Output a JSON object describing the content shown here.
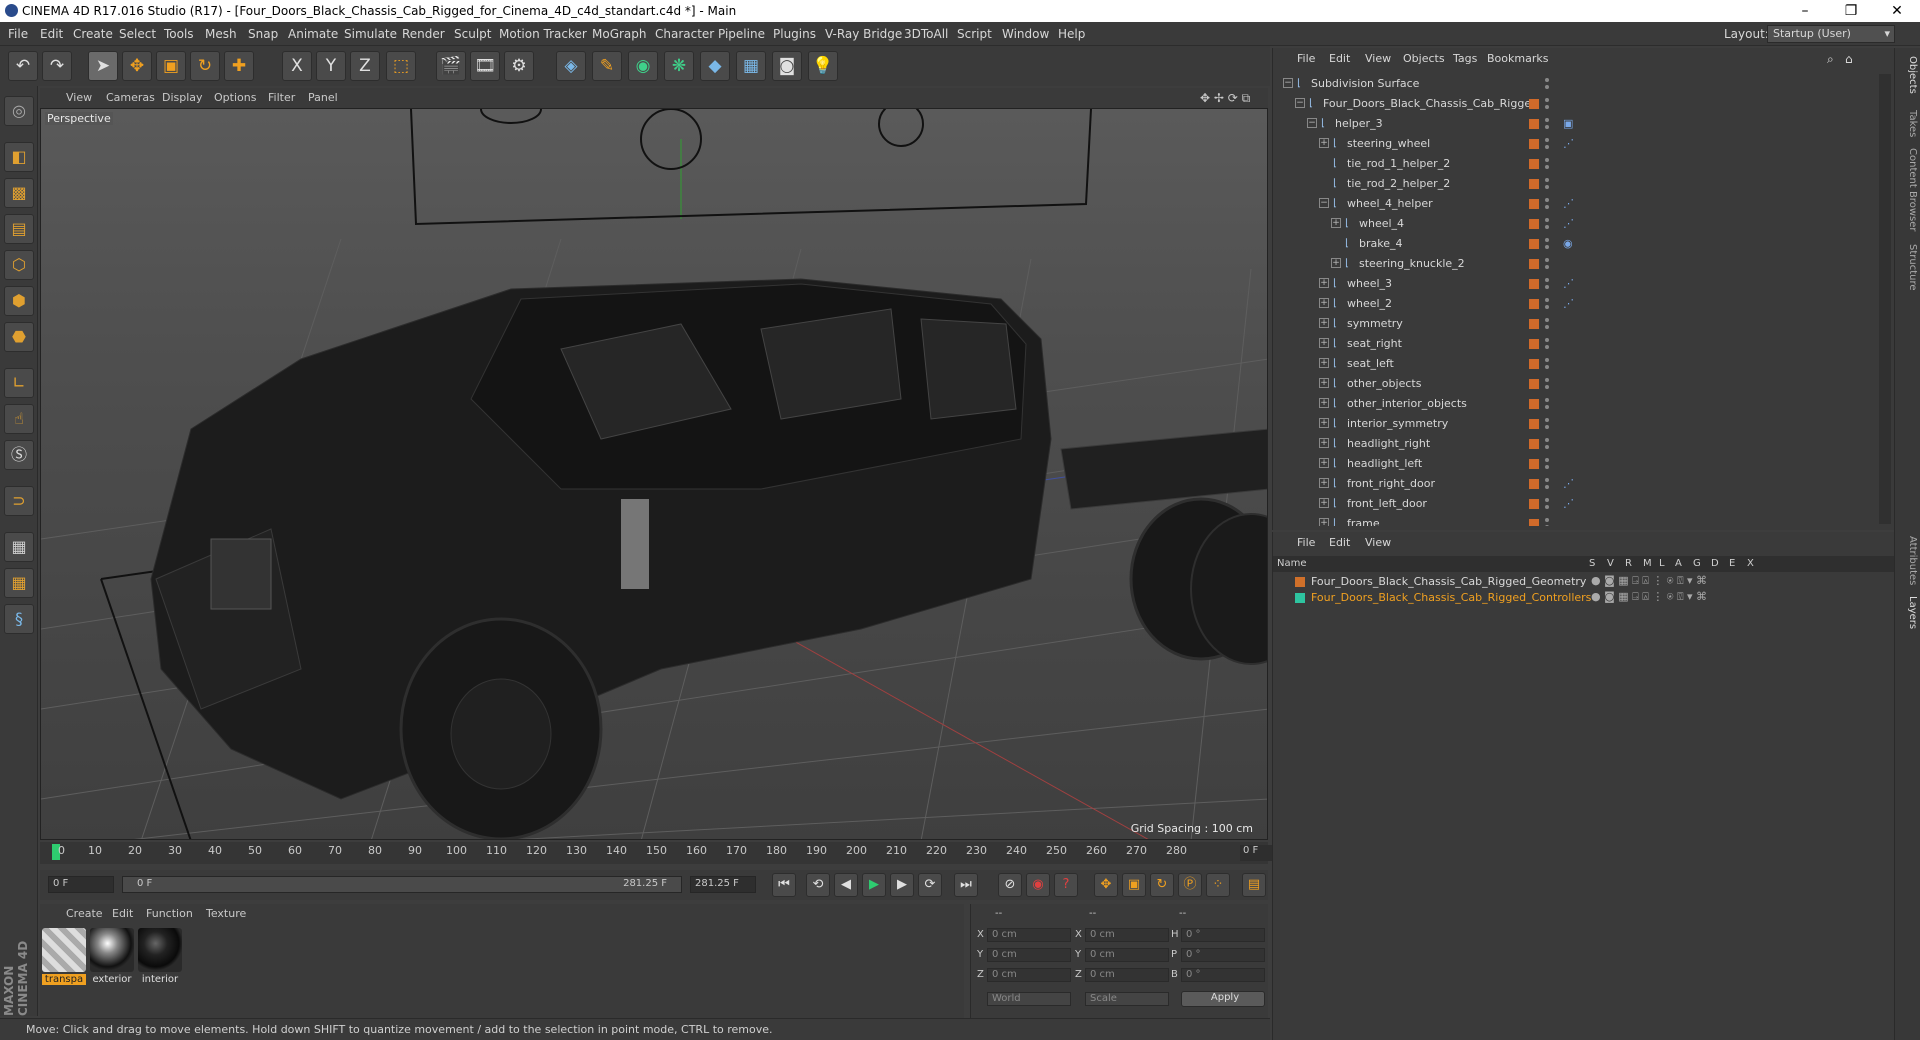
{
  "window": {
    "title": "CINEMA 4D R17.016 Studio (R17) - [Four_Doors_Black_Chassis_Cab_Rigged_for_Cinema_4D_c4d_standart.c4d *] - Main",
    "minimize": "–",
    "maximize": "❐",
    "close": "✕"
  },
  "menubar": {
    "items": [
      "File",
      "Edit",
      "Create",
      "Select",
      "Tools",
      "Mesh",
      "Snap",
      "Animate",
      "Simulate",
      "Render",
      "Sculpt",
      "Motion Tracker",
      "MoGraph",
      "Character",
      "Pipeline",
      "Plugins",
      "V-Ray Bridge",
      "3DToAll",
      "Script",
      "Window",
      "Help"
    ],
    "layout_label": "Layout:",
    "layout_value": "Startup (User)"
  },
  "toolbar": {
    "icons": [
      "undo-icon",
      "redo-icon",
      "select-cursor-icon",
      "move-icon",
      "scale-icon",
      "rotate-icon",
      "live-select-icon",
      "x-axis-icon",
      "y-axis-icon",
      "z-axis-icon",
      "coordinate-system-icon",
      "render-view-icon",
      "render-picture-viewer-icon",
      "edit-render-settings-icon",
      "cube-icon",
      "pen-icon",
      "subdivision-icon",
      "array-icon",
      "deformer-icon",
      "floor-icon",
      "camera-icon",
      "light-icon"
    ],
    "x_label": "X",
    "y_label": "Y",
    "z_label": "Z"
  },
  "lefttools": {
    "icons": [
      "make-editable-icon",
      "model-mode-icon",
      "texture-mode-icon",
      "workplane-icon",
      "points-mode-icon",
      "edges-mode-icon",
      "polygons-mode-icon",
      "axis-mode-icon",
      "tweak-icon",
      "solo-icon",
      "magnet-icon",
      "locked-workplane-icon",
      "snap-icon",
      "python-icon"
    ]
  },
  "viewport": {
    "menu": [
      "View",
      "Cameras",
      "Display",
      "Options",
      "Filter",
      "Panel"
    ],
    "label": "Perspective",
    "grid_spacing": "Grid Spacing : 100 cm"
  },
  "timeline": {
    "ticks": [
      "0",
      "10",
      "20",
      "30",
      "40",
      "50",
      "60",
      "70",
      "80",
      "90",
      "100",
      "110",
      "120",
      "130",
      "140",
      "150",
      "160",
      "170",
      "180",
      "190",
      "200",
      "210",
      "220",
      "230",
      "240",
      "250",
      "260",
      "270",
      "280"
    ],
    "current_frame": "0 F"
  },
  "transport": {
    "start": "0 F",
    "range_start": "0 F",
    "range_end": "281.25 F",
    "end": "281.25 F"
  },
  "materials": {
    "menu": [
      "Create",
      "Edit",
      "Function",
      "Texture"
    ],
    "items": [
      {
        "label": "transpa"
      },
      {
        "label": "exterior"
      },
      {
        "label": "interior"
      }
    ]
  },
  "coords": {
    "headers": [
      "--",
      "--",
      "--"
    ],
    "rows": [
      {
        "a": "X",
        "av": "0 cm",
        "b": "X",
        "bv": "0 cm",
        "c": "H",
        "cv": "0 °"
      },
      {
        "a": "Y",
        "av": "0 cm",
        "b": "Y",
        "bv": "0 cm",
        "c": "P",
        "cv": "0 °"
      },
      {
        "a": "Z",
        "av": "0 cm",
        "b": "Z",
        "bv": "0 cm",
        "c": "B",
        "cv": "0 °"
      }
    ],
    "world": "World",
    "scale": "Scale",
    "apply": "Apply"
  },
  "status": {
    "text": "Move: Click and drag to move elements. Hold down SHIFT to quantize movement / add to the selection in point mode, CTRL to remove.",
    "brand": "MAXON CINEMA 4D"
  },
  "objects": {
    "menu": [
      "File",
      "Edit",
      "View",
      "Objects",
      "Tags",
      "Bookmarks"
    ],
    "rows": [
      {
        "name": "Subdivision Surface",
        "depth": 0,
        "exp": "−",
        "tags": ""
      },
      {
        "name": "Four_Doors_Black_Chassis_Cab_Rigged",
        "depth": 1,
        "exp": "−",
        "tags": ""
      },
      {
        "name": "helper_3",
        "depth": 2,
        "exp": "−",
        "tags": "▣"
      },
      {
        "name": "steering_wheel",
        "depth": 3,
        "exp": "+",
        "tags": "⋰"
      },
      {
        "name": "tie_rod_1_helper_2",
        "depth": 3,
        "exp": "",
        "tags": ""
      },
      {
        "name": "tie_rod_2_helper_2",
        "depth": 3,
        "exp": "",
        "tags": ""
      },
      {
        "name": "wheel_4_helper",
        "depth": 3,
        "exp": "−",
        "tags": "⋰"
      },
      {
        "name": "wheel_4",
        "depth": 4,
        "exp": "+",
        "tags": "⋰"
      },
      {
        "name": "brake_4",
        "depth": 4,
        "exp": "",
        "tags": "◉"
      },
      {
        "name": "steering_knuckle_2",
        "depth": 4,
        "exp": "+",
        "tags": ""
      },
      {
        "name": "wheel_3",
        "depth": 3,
        "exp": "+",
        "tags": "⋰"
      },
      {
        "name": "wheel_2",
        "depth": 3,
        "exp": "+",
        "tags": "⋰"
      },
      {
        "name": "symmetry",
        "depth": 3,
        "exp": "+",
        "tags": ""
      },
      {
        "name": "seat_right",
        "depth": 3,
        "exp": "+",
        "tags": ""
      },
      {
        "name": "seat_left",
        "depth": 3,
        "exp": "+",
        "tags": ""
      },
      {
        "name": "other_objects",
        "depth": 3,
        "exp": "+",
        "tags": ""
      },
      {
        "name": "other_interior_objects",
        "depth": 3,
        "exp": "+",
        "tags": ""
      },
      {
        "name": "interior_symmetry",
        "depth": 3,
        "exp": "+",
        "tags": ""
      },
      {
        "name": "headlight_right",
        "depth": 3,
        "exp": "+",
        "tags": ""
      },
      {
        "name": "headlight_left",
        "depth": 3,
        "exp": "+",
        "tags": ""
      },
      {
        "name": "front_right_door",
        "depth": 3,
        "exp": "+",
        "tags": "⋰"
      },
      {
        "name": "front_left_door",
        "depth": 3,
        "exp": "+",
        "tags": "⋰"
      },
      {
        "name": "frame",
        "depth": 3,
        "exp": "+",
        "tags": ""
      }
    ]
  },
  "layers": {
    "menu": [
      "File",
      "Edit",
      "View"
    ],
    "head_name": "Name",
    "columns": [
      "S",
      "V",
      "R",
      "M",
      "L",
      "A",
      "G",
      "D",
      "E",
      "X"
    ],
    "rows": [
      {
        "name": "Four_Doors_Black_Chassis_Cab_Rigged_Geometry",
        "color": "#d0702a",
        "text_color": "#d8d8d8"
      },
      {
        "name": "Four_Doors_Black_Chassis_Cab_Rigged_Controllers",
        "color": "#2ec4a0",
        "text_color": "#f0a020"
      }
    ]
  },
  "vtabs": [
    "Objects",
    "Takes",
    "Content Browser",
    "Structure",
    "Attributes",
    "Layers"
  ],
  "colors": {
    "accent": "#f0a020",
    "layer_orange": "#d06a2a",
    "selection_blue": "#7ab8e8"
  }
}
